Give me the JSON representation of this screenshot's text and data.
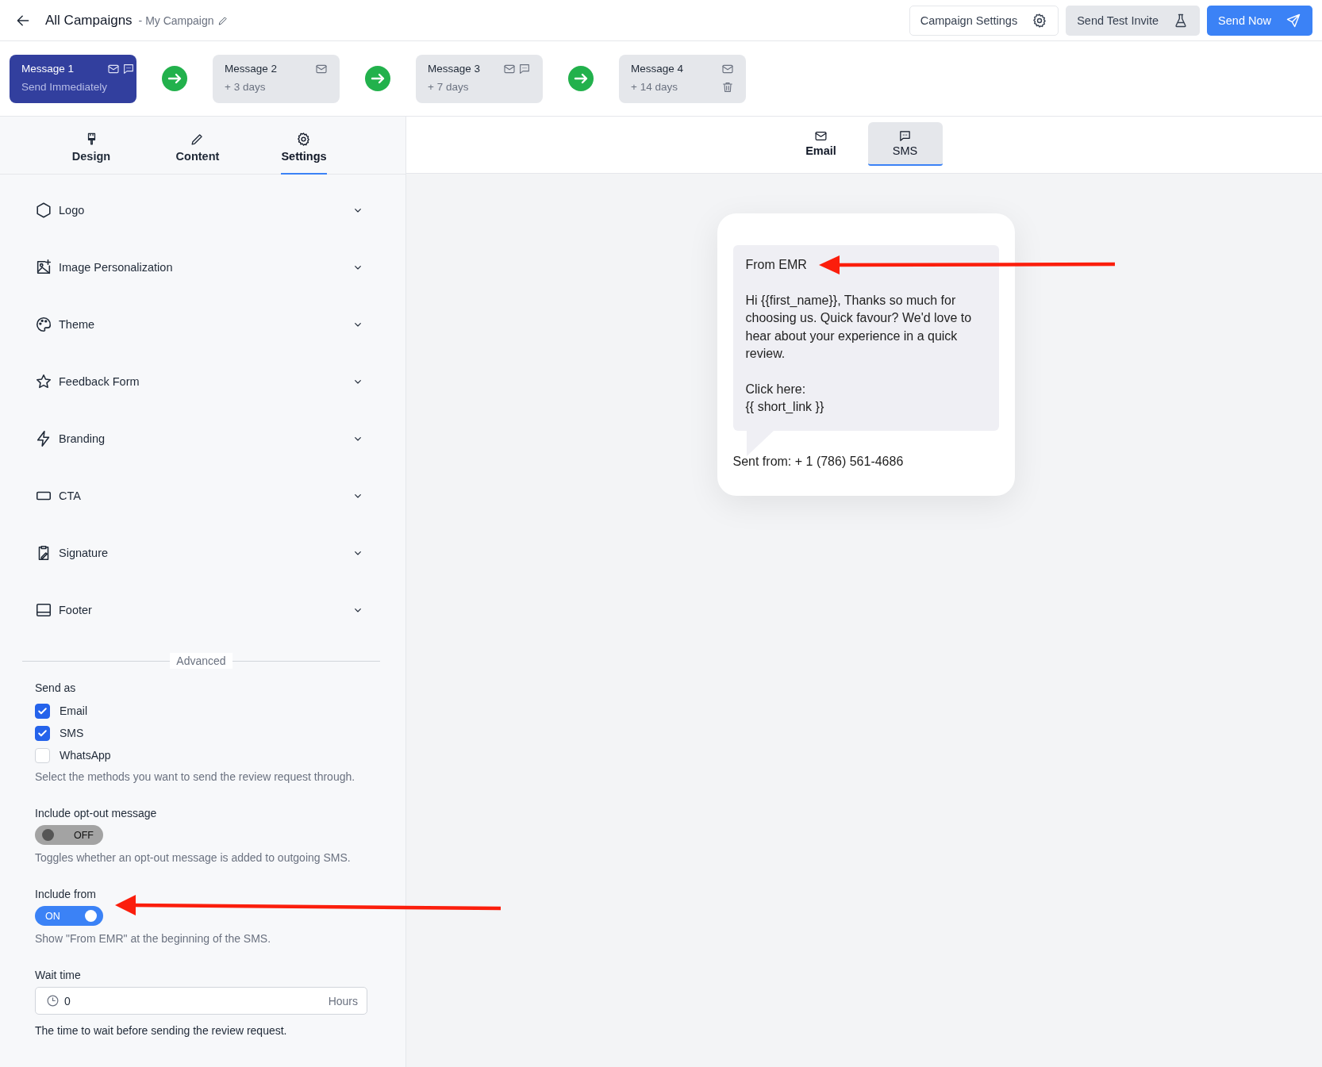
{
  "header": {
    "back_label": "All Campaigns",
    "subtitle": "- My Campaign",
    "buttons": [
      {
        "label": "Campaign Settings",
        "kind": "outline"
      },
      {
        "label": "Send Test Invite",
        "kind": "secondary"
      },
      {
        "label": "Send Now",
        "kind": "primary"
      }
    ]
  },
  "messages": [
    {
      "title": "Message 1",
      "delay": "Send Immediately",
      "selected": true,
      "email": true,
      "sms": true,
      "deletable": false
    },
    {
      "title": "Message 2",
      "delay": "+ 3 days",
      "selected": false,
      "email": true,
      "sms": false,
      "deletable": false
    },
    {
      "title": "Message 3",
      "delay": "+ 7 days",
      "selected": false,
      "email": true,
      "sms": true,
      "deletable": false
    },
    {
      "title": "Message 4",
      "delay": "+ 14 days",
      "selected": false,
      "email": true,
      "sms": false,
      "deletable": true
    }
  ],
  "editor_tabs": [
    {
      "label": "Design",
      "selected": false
    },
    {
      "label": "Content",
      "selected": false
    },
    {
      "label": "Settings",
      "selected": true
    }
  ],
  "settings_sections": [
    {
      "label": "Logo"
    },
    {
      "label": "Image Personalization"
    },
    {
      "label": "Theme"
    },
    {
      "label": "Feedback Form"
    },
    {
      "label": "Branding"
    },
    {
      "label": "CTA"
    },
    {
      "label": "Signature"
    },
    {
      "label": "Footer"
    }
  ],
  "advanced": {
    "title": "Advanced",
    "send_as": {
      "label": "Send as",
      "options": [
        {
          "label": "Email",
          "checked": true
        },
        {
          "label": "SMS",
          "checked": true
        },
        {
          "label": "WhatsApp",
          "checked": false
        }
      ],
      "help": "Select the methods you want to send the review request through."
    },
    "toggles": [
      {
        "label": "Include opt-out message",
        "on": false,
        "state_text": "OFF",
        "help": "Toggles whether an opt-out message is added to outgoing SMS."
      },
      {
        "label": "Include from",
        "on": true,
        "state_text": "ON",
        "help": "Show \"From EMR\" at the beginning of the SMS."
      }
    ],
    "wait_time": {
      "label": "Wait time",
      "value": "0",
      "unit": "Hours",
      "help": "The time to wait before sending the review request."
    }
  },
  "preview": {
    "tabs": [
      {
        "label": "Email",
        "selected": false
      },
      {
        "label": "SMS",
        "selected": true
      }
    ],
    "sms": {
      "from_line": "From EMR",
      "body": "Hi {{first_name}}, Thanks so much for choosing us. Quick favour? We'd love to hear about your experience in a quick review.",
      "click_label": "Click here:",
      "link": "{{ short_link }}",
      "sent_from": "Sent from: + 1 (786) 561-4686"
    }
  }
}
